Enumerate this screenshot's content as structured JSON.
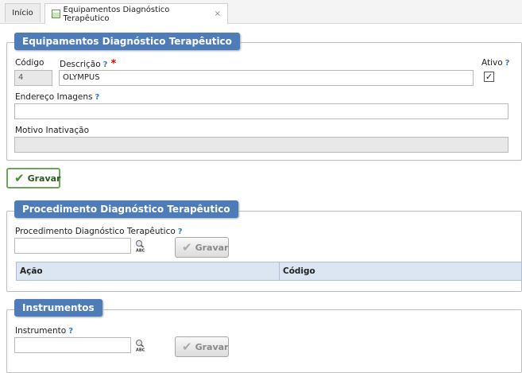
{
  "tabs": [
    {
      "label": "Início"
    },
    {
      "label": "Equipamentos Diagnóstico Terapêutico",
      "close": "×"
    }
  ],
  "equip": {
    "legend": "Equipamentos Diagnóstico Terapêutico",
    "codigo_label": "Código",
    "codigo_value": "4",
    "descricao_label": "Descrição",
    "descricao_value": "OLYMPUS",
    "ativo_label": "Ativo",
    "ativo_checked": true,
    "endereco_label": "Endereço Imagens",
    "endereco_value": "",
    "motivo_label": "Motivo Inativação",
    "motivo_value": "",
    "help": "?",
    "required": "*"
  },
  "main_save_label": "Gravar",
  "proc": {
    "legend": "Procedimento Diagnóstico Terapêutico",
    "field_label": "Procedimento Diagnóstico Terapêutico",
    "field_value": "",
    "save_label": "Gravar",
    "columns": [
      "Ação",
      "Código"
    ]
  },
  "instr": {
    "legend": "Instrumentos",
    "field_label": "Instrumento",
    "field_value": "",
    "save_label": "Gravar"
  },
  "icons": {
    "check": "check-icon",
    "search": "search-abc-icon",
    "help": "help-icon",
    "tab": "table-icon"
  },
  "colors": {
    "legend": "#4d7cb9",
    "help": "#2c7fc7",
    "required": "#dd0000",
    "grid_header": "#dce6f3",
    "primary_border": "#6da35b"
  }
}
